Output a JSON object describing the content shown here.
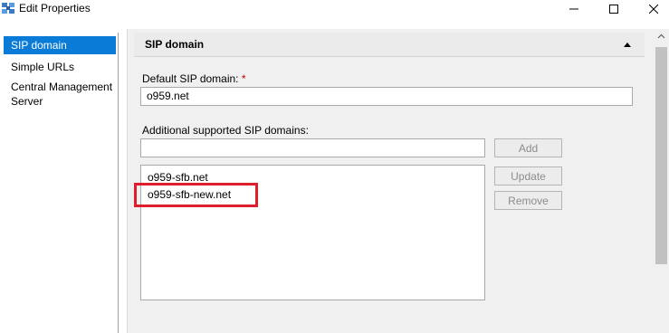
{
  "window": {
    "title": "Edit Properties"
  },
  "nav": {
    "items": [
      {
        "label": "SIP domain",
        "selected": true
      },
      {
        "label": "Simple URLs",
        "selected": false
      },
      {
        "label": "Central Management",
        "label2": "Server",
        "selected": false
      }
    ]
  },
  "section": {
    "title": "SIP domain"
  },
  "default_domain": {
    "label": "Default SIP domain:",
    "required_marker": "*",
    "value": "o959.net"
  },
  "additional": {
    "label": "Additional supported SIP domains:",
    "input_value": "",
    "add_label": "Add",
    "update_label": "Update",
    "remove_label": "Remove",
    "items": [
      "o959-sfb.net",
      "o959-sfb-new.net"
    ]
  },
  "colors": {
    "selection": "#0a7bd6",
    "highlight_border": "#e01e2b",
    "required": "#c00000"
  }
}
